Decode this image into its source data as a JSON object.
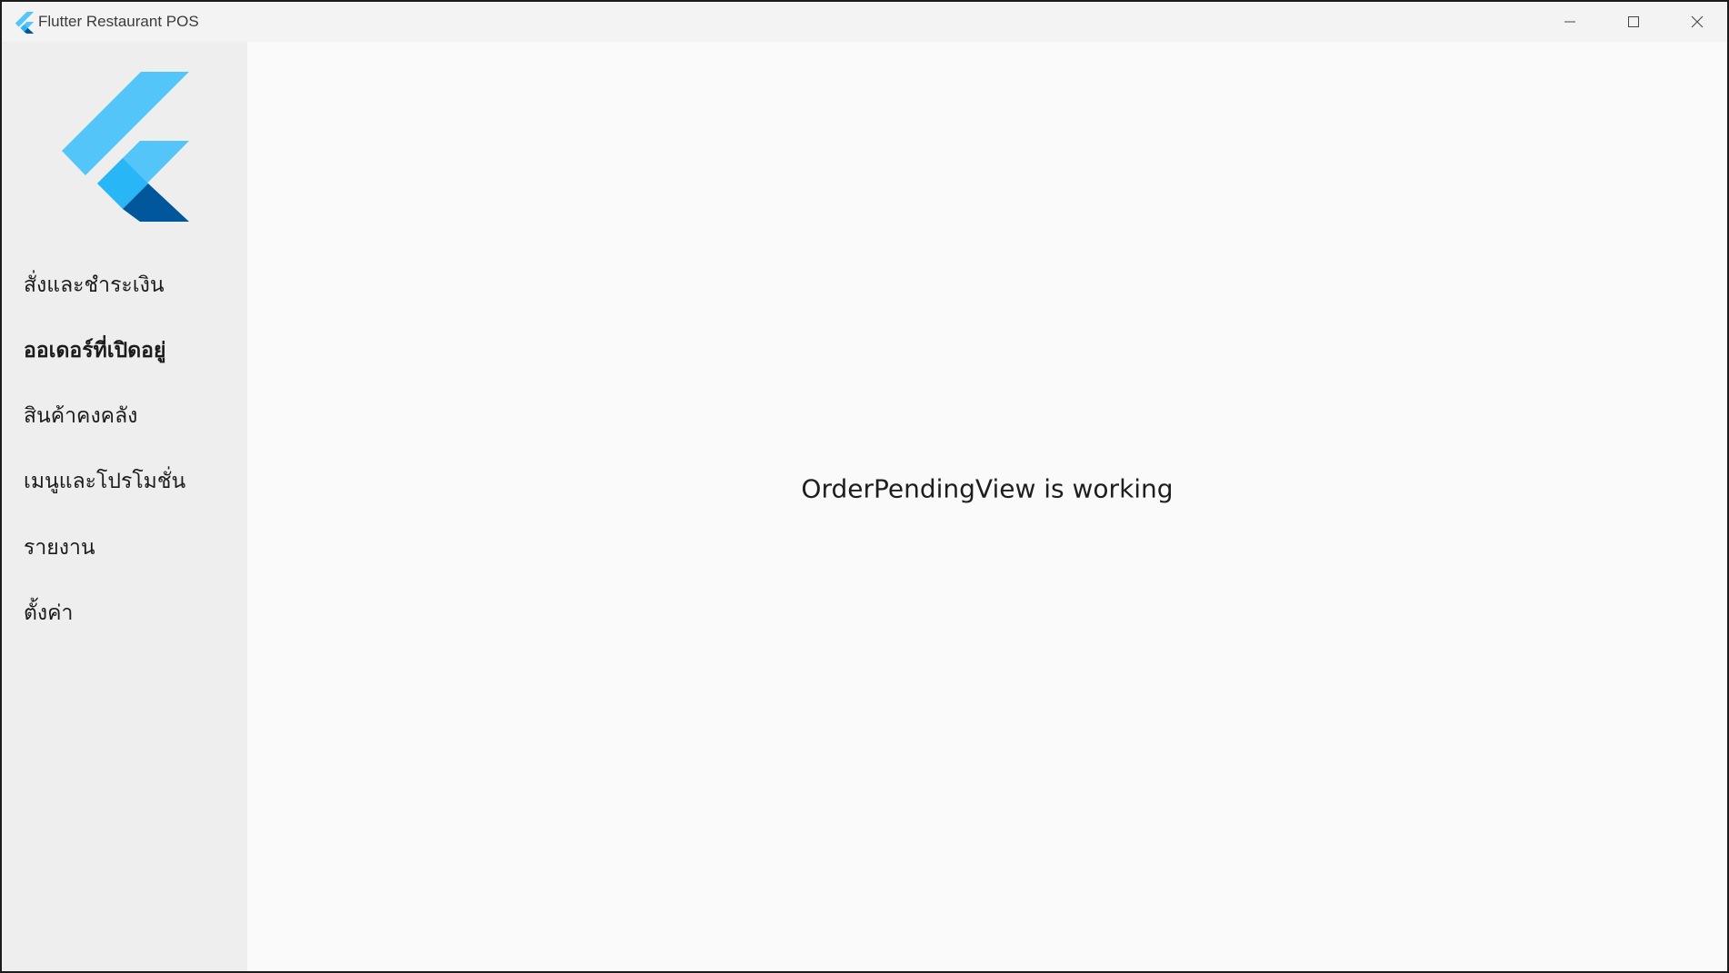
{
  "window": {
    "title": "Flutter Restaurant POS",
    "controls": {
      "minimize_icon": "minimize-icon",
      "maximize_icon": "maximize-icon",
      "close_icon": "close-icon"
    }
  },
  "sidebar": {
    "logo": "flutter-logo",
    "items": [
      {
        "label": "สั่งและชำระเงิน",
        "active": false
      },
      {
        "label": "ออเดอร์ที่เปิดอยู่",
        "active": true
      },
      {
        "label": "สินค้าคงคลัง",
        "active": false
      },
      {
        "label": "เมนูและโปรโมชั่น",
        "active": false
      },
      {
        "label": "รายงาน",
        "active": false
      },
      {
        "label": "ตั้งค่า",
        "active": false
      }
    ]
  },
  "main": {
    "message": "OrderPendingView is working"
  },
  "colors": {
    "sidebar_bg": "#eeeeee",
    "content_bg": "#fafafa",
    "logo_light": "#54c5f8",
    "logo_mid": "#29b6f6",
    "logo_dark": "#01579b"
  }
}
